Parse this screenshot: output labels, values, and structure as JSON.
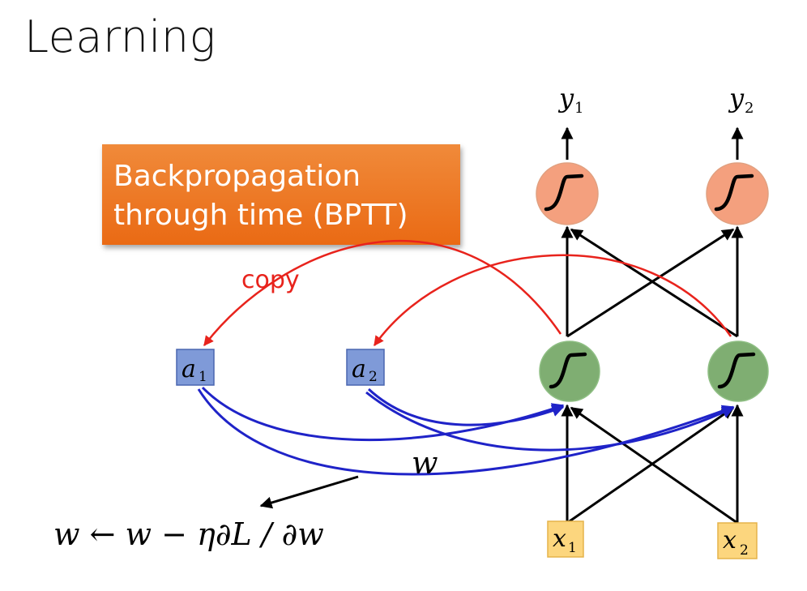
{
  "title": "Learning",
  "bptt": {
    "line1": "Backpropagation",
    "line2": "through time (BPTT)"
  },
  "copy_label": "copy",
  "weight_label": "w",
  "update_rule": "w ← w − η∂L / ∂w",
  "memory": [
    {
      "name": "a",
      "sub": "1"
    },
    {
      "name": "a",
      "sub": "2"
    }
  ],
  "inputs": [
    {
      "name": "x",
      "sub": "1"
    },
    {
      "name": "x",
      "sub": "2"
    }
  ],
  "outputs": [
    {
      "name": "y",
      "sub": "1"
    },
    {
      "name": "y",
      "sub": "2"
    }
  ],
  "colors": {
    "copy_arrow": "#e8231c",
    "weight_arrow": "#1f23c8",
    "hidden_neuron": "#7fae72",
    "output_neuron": "#f4a07e",
    "memory_box": "#7f9ad8",
    "input_box": "#fcd67e",
    "bptt_box": "#ee7420"
  }
}
